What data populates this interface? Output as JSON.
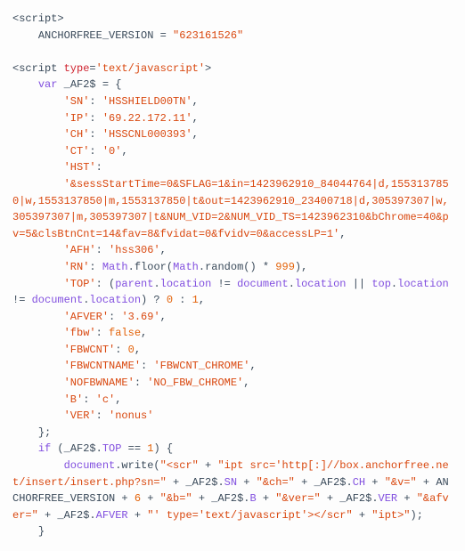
{
  "lines": {
    "l1_open": "<script>",
    "l2a": "    ANCHORFREE_VERSION ",
    "l2b": "=",
    "l2c": " ",
    "l2d": "\"623161526\"",
    "l3": "",
    "l4_open": "<script ",
    "l4_attr": "type",
    "l4_eq": "=",
    "l4_val": "'text/javascript'",
    "l4_close": ">",
    "l5a": "    ",
    "l5b": "var",
    "l5c": " _AF2$ ",
    "l5d": "=",
    "l5e": " {",
    "kv": [
      {
        "k": "'SN'",
        "v": "'HSSHIELD00TN'",
        "t": "str"
      },
      {
        "k": "'IP'",
        "v": "'69.22.172.11'",
        "t": "str"
      },
      {
        "k": "'CH'",
        "v": "'HSSCNL000393'",
        "t": "str"
      },
      {
        "k": "'CT'",
        "v": "'0'",
        "t": "str"
      }
    ],
    "hst_key": "'HST'",
    "hst_val": "'&sessStartTime=0&SFLAG=1&in=1423962910_84044764|d,1553137850|w,1553137850|m,1553137850|t&out=1423962910_23400718|d,305397307|w,305397307|m,305397307|t&NUM_VID=2&NUM_VID_TS=1423962310&bChrome=40&pv=5&clsBtnCnt=14&fav=8&fvidat=0&fvidv=0&accessLP=1'",
    "afh_key": "'AFH'",
    "afh_val": "'hss306'",
    "rn_key": "'RN'",
    "rn_a": "Math",
    "rn_b": ".floor(",
    "rn_c": "Math",
    "rn_d": ".random() ",
    "rn_e": "*",
    "rn_f": " ",
    "rn_g": "999",
    "rn_h": "),",
    "top_key": "'TOP'",
    "top_a": "(",
    "top_b": "parent",
    "top_c": ".",
    "top_d": "location",
    "top_e": " != ",
    "top_f": "document",
    "top_g": ".",
    "top_h": "location",
    "top_i": " || ",
    "top_j": "top",
    "top_k": ".",
    "top_l": "location",
    "top_m": " != ",
    "top_n": "document",
    "top_o": ".",
    "top_p": "location",
    "top_q": ") ? ",
    "top_r": "0",
    "top_s": " : ",
    "top_t": "1",
    "top_u": ",",
    "kv2": [
      {
        "k": "'AFVER'",
        "v": "'3.69'",
        "t": "str"
      },
      {
        "k": "'fbw'",
        "v": "false",
        "t": "bool"
      },
      {
        "k": "'FBWCNT'",
        "v": "0",
        "t": "num"
      },
      {
        "k": "'FBWCNTNAME'",
        "v": "'FBWCNT_CHROME'",
        "t": "str"
      },
      {
        "k": "'NOFBWNAME'",
        "v": "'NO_FBW_CHROME'",
        "t": "str"
      },
      {
        "k": "'B'",
        "v": "'c'",
        "t": "str"
      },
      {
        "k": "'VER'",
        "v": "'nonus'",
        "t": "str",
        "last": true
      }
    ],
    "close_obj": "    };",
    "if_a": "    ",
    "if_b": "if",
    "if_c": " (_AF2$.",
    "if_d": "TOP",
    "if_e": " == ",
    "if_f": "1",
    "if_g": ") {",
    "dw_a": "        ",
    "dw_b": "document",
    "dw_c": ".write(",
    "dw_d": "\"<scr\"",
    "dw_e": " + ",
    "dw_f": "\"ipt src='http[:]//box.anchorfree.net/insert/insert.php?sn=\"",
    "dw_g": " + _AF2$.",
    "dw_h": "SN",
    "dw_i": " + ",
    "dw_j": "\"&ch=\"",
    "dw_k": " + _AF2$.",
    "dw_l": "CH",
    "dw_m": " + ",
    "dw_n": "\"&v=\"",
    "dw_o": " + ANCHORFREE_VERSION + ",
    "dw_p": "6",
    "dw_q": " + ",
    "dw_r": "\"&b=\"",
    "dw_s": " + _AF2$.",
    "dw_t": "B",
    "dw_u": " + ",
    "dw_v": "\"&ver=\"",
    "dw_w": " + _AF2$.",
    "dw_x": "VER",
    "dw_y": " + ",
    "dw_z": "\"&afver=\"",
    "dw_za": " + _AF2$.",
    "dw_zb": "AFVER",
    "dw_zc": " + ",
    "dw_zd": "\"' type='text/javascript'></scr\"",
    "dw_ze": " + ",
    "dw_zf": "\"ipt>\"",
    "dw_zg": ");",
    "close_if": "    }"
  }
}
